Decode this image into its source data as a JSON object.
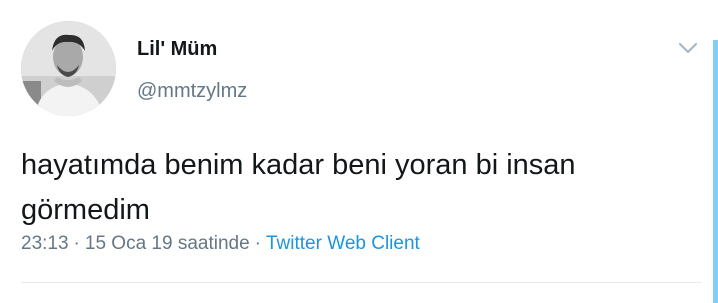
{
  "tweet": {
    "display_name": "Lil' Müm",
    "handle": "@mmtzylmz",
    "text": "hayatımda benim kadar beni yoran bi insan görmedim",
    "time": "23:13",
    "separator": "·",
    "date": "15 Oca 19 saatinde",
    "client": "Twitter Web Client"
  },
  "icons": {
    "menu": "chevron-down-icon"
  },
  "colors": {
    "text": "#14171a",
    "secondary": "#657786",
    "link": "#1b95e0"
  }
}
